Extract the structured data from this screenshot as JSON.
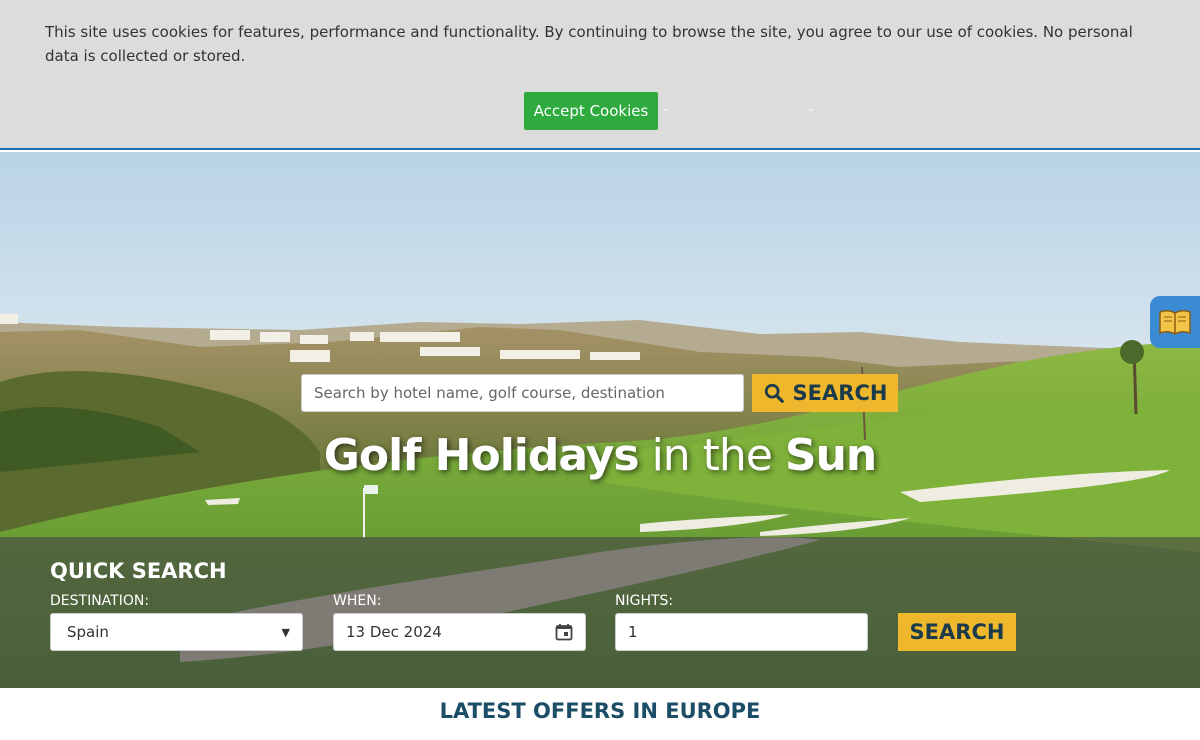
{
  "cookie_banner": {
    "text": "This site uses cookies for features, performance and functionality. By continuing to browse the site, you agree to our use of cookies. No personal data is collected or stored.",
    "accept_label": "Accept Cookies",
    "accept_color": "#2eaa3f"
  },
  "hero": {
    "search": {
      "placeholder": "Search by hotel name, golf course, destination",
      "button_label": "SEARCH",
      "button_icon": "search-icon"
    },
    "title": {
      "part1": "Golf Holidays",
      "part2": " in the ",
      "part3": "Sun"
    },
    "side_tab_icon": "book-icon"
  },
  "quick_search": {
    "title": "QUICK SEARCH",
    "destination_label": "DESTINATION:",
    "destination_value": "Spain",
    "when_label": "WHEN:",
    "when_value": "13 Dec 2024",
    "nights_label": "NIGHTS:",
    "nights_value": "1",
    "search_label": "SEARCH"
  },
  "section": {
    "title": "LATEST OFFERS IN EUROPE"
  },
  "colors": {
    "accent": "#efb82c",
    "dark_text": "#1b3b4b",
    "heading": "#1b4d66",
    "tab_blue": "#3a8ad4"
  }
}
